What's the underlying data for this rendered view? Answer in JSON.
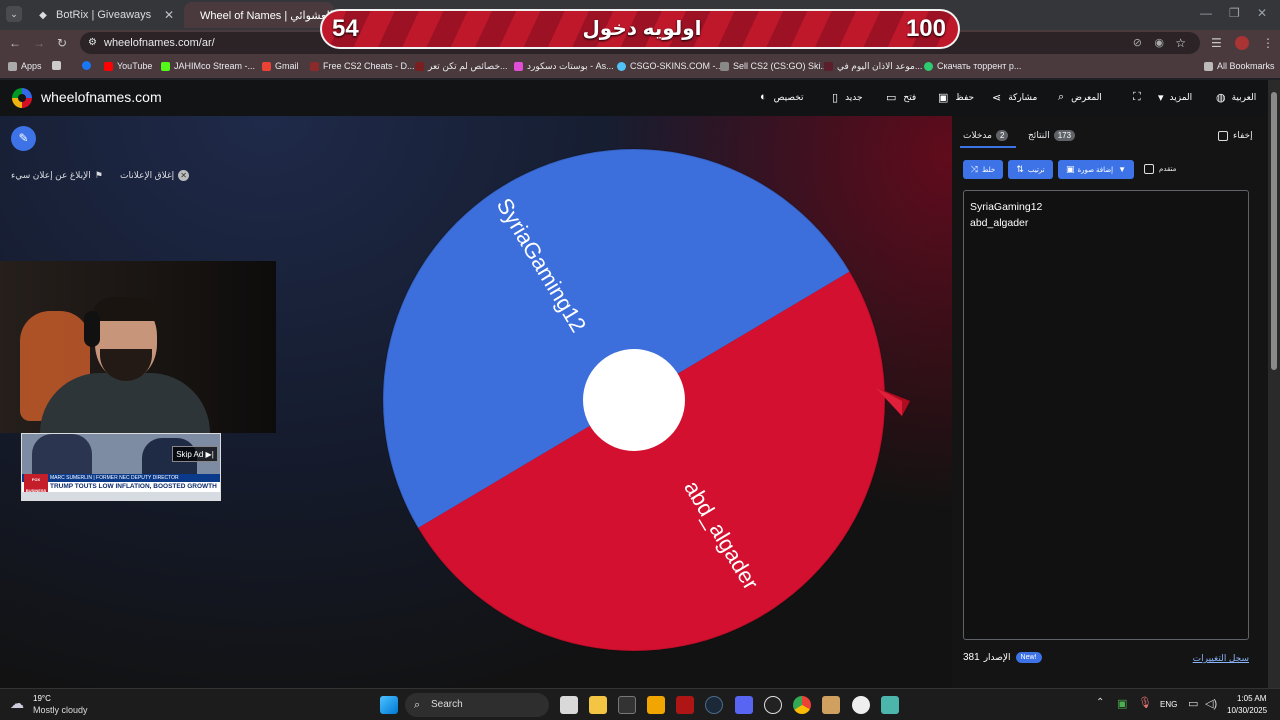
{
  "tabs": [
    {
      "title": "BotRix | Giveaways",
      "icon": "diamond-icon"
    },
    {
      "title": "Wheel of Names | اسم العشوائي",
      "icon": "wheel-icon"
    }
  ],
  "scoreboard": {
    "left": "54",
    "center": "اولويه دخول",
    "right": "100"
  },
  "address": {
    "url": "wheelofnames.com/ar/"
  },
  "bookmarks": [
    "Apps",
    "YouTube",
    "JAHIMco Stream -...",
    "Gmail",
    "Free CS2 Cheats - D...",
    "خصائص لم تكن تعر...",
    "بوستات دسكورد - As...",
    "CSGO-SKINS.COM -...",
    "Sell CS2 (CS:GO) Ski...",
    "موعد الاذان اليوم في...",
    "Скачать торрент р...",
    "All Bookmarks"
  ],
  "site": {
    "name": "wheelofnames.com",
    "nav": {
      "language": "العربية",
      "more": "المزيد",
      "gallery": "المعرض",
      "share": "مشاركة",
      "save": "حفظ",
      "open": "فتح",
      "new": "جديد",
      "customize": "تخصيص"
    }
  },
  "ads": {
    "close": "إغلاق الإعلانات",
    "report": "الإبلاغ عن إعلان سيء"
  },
  "ad_video": {
    "skip": "Skip Ad ▶|",
    "headline": "TRUMP TOUTS LOW INFLATION, BOOSTED GROWTH",
    "lower": "MARC SUMERLIN | FORMER NEC DEPUTY DIRECTOR",
    "network": "FOX BUSINESS"
  },
  "wheel": {
    "segments": [
      {
        "label": "SyriaGaming12",
        "color": "#3d6fdc"
      },
      {
        "label": "abd_algader",
        "color": "#d3102f"
      }
    ]
  },
  "panel": {
    "tab_entries": "مدخلات",
    "entries_count": "2",
    "tab_results": "النتائج",
    "results_count": "173",
    "hide": "إخفاء",
    "shuffle": "خلط",
    "sort": "ترتيب",
    "add_image": "إضافة صورة",
    "advanced": "متقدم",
    "entries": [
      "SyriaGaming12",
      "abd_algader"
    ],
    "version_label": "الإصدار",
    "version": "381",
    "new": "New!",
    "changelog": "سجل التغييرات"
  },
  "taskbar": {
    "temp": "19°C",
    "weather": "Mostly cloudy",
    "search": "Search",
    "lang": "ENG",
    "time": "1:05 AM",
    "date": "10/30/2025"
  }
}
